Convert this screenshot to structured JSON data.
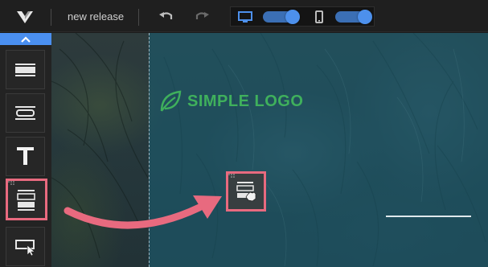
{
  "toolbar": {
    "release_name": "new release",
    "icons": {
      "logo": "brand-logo-icon",
      "undo": "undo-icon",
      "redo": "redo-icon",
      "desktop": "desktop-icon",
      "mobile": "mobile-icon"
    },
    "desktop_toggle_on": true,
    "mobile_toggle_on": true
  },
  "sidebar": {
    "collapse_icon": "chevron-up-icon",
    "blocks": [
      {
        "name": "header-block",
        "icon": "header-layout-icon"
      },
      {
        "name": "button-block",
        "icon": "button-layout-icon"
      },
      {
        "name": "text-block",
        "icon": "text-icon"
      },
      {
        "name": "section-block",
        "icon": "section-layout-icon",
        "selected": true
      },
      {
        "name": "select-block",
        "icon": "cursor-select-icon"
      }
    ]
  },
  "canvas": {
    "brand_text": "SIMPLE LOGO",
    "brand_icon": "leaf-icon",
    "drop_icon": "section-drag-icon"
  },
  "colors": {
    "accent": "#4a8ff0",
    "highlight": "#e86a7f",
    "brand": "#3fb05c",
    "overlay": "#1c5c70"
  }
}
